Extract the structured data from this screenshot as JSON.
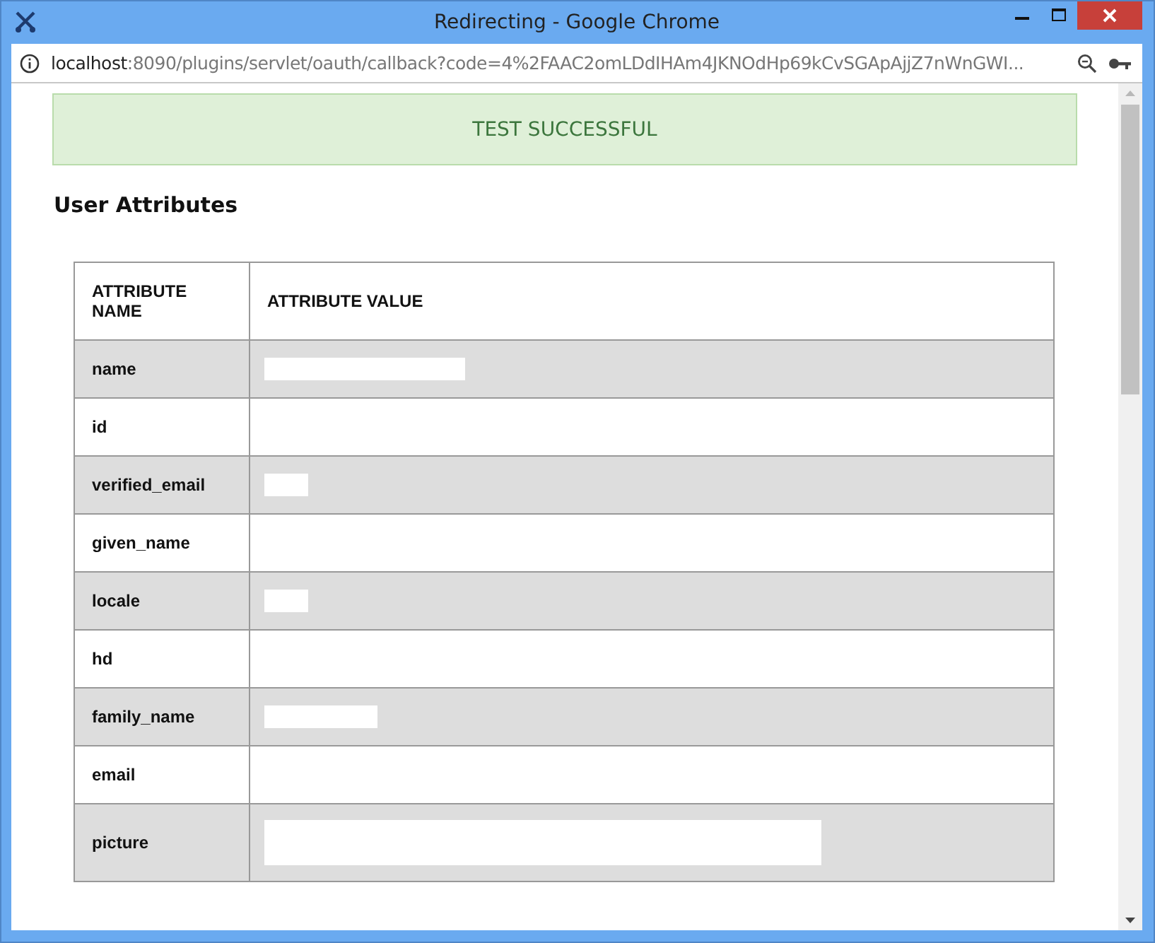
{
  "window": {
    "title": "Redirecting - Google Chrome"
  },
  "address_bar": {
    "host": "localhost",
    "path": ":8090/plugins/servlet/oauth/callback?code=4%2FAAC2omLDdIHAm4JKNOdHp69kCvSGApAjjZ7nWnGWI..."
  },
  "banner": {
    "text": "TEST SUCCESSFUL"
  },
  "section_title": "User Attributes",
  "table": {
    "columns": [
      "ATTRIBUTE NAME",
      "ATTRIBUTE VALUE"
    ],
    "rows": [
      {
        "name": "name",
        "kind": "medium"
      },
      {
        "name": "id",
        "kind": "empty"
      },
      {
        "name": "verified_email",
        "kind": "short"
      },
      {
        "name": "given_name",
        "kind": "empty"
      },
      {
        "name": "locale",
        "kind": "short"
      },
      {
        "name": "hd",
        "kind": "empty"
      },
      {
        "name": "family_name",
        "kind": "small"
      },
      {
        "name": "email",
        "kind": "empty"
      },
      {
        "name": "picture",
        "kind": "long"
      }
    ]
  }
}
